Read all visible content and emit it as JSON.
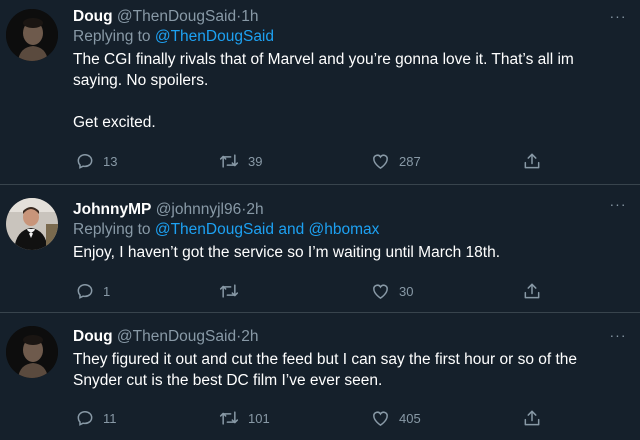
{
  "tweets": [
    {
      "name": "Doug",
      "handle": "@ThenDougSaid",
      "dot": "·",
      "time": "1h",
      "reply_prefix": "Replying to ",
      "reply_to": [
        "@ThenDougSaid"
      ],
      "reply_joiner": "",
      "paragraphs": [
        "The CGI finally rivals that of Marvel and you’re gonna love it. That’s all im saying. No spoilers.",
        "Get excited."
      ],
      "replies": "13",
      "retweets": "39",
      "likes": "287"
    },
    {
      "name": "JohnnyMP",
      "handle": "@johnnyjl96",
      "dot": "·",
      "time": "2h",
      "reply_prefix": "Replying to ",
      "reply_to": [
        "@ThenDougSaid",
        "@hbomax"
      ],
      "reply_joiner": " and ",
      "paragraphs": [
        "Enjoy, I haven’t got the service so I’m waiting until March 18th."
      ],
      "replies": "1",
      "retweets": "",
      "likes": "30"
    },
    {
      "name": "Doug",
      "handle": "@ThenDougSaid",
      "dot": "·",
      "time": "2h",
      "paragraphs": [
        "They figured it out and cut the feed but I can say the first hour or so of the Snyder cut is the best DC film I’ve ever seen."
      ],
      "replies": "11",
      "retweets": "101",
      "likes": "405"
    }
  ],
  "icons": {
    "reply": "reply-icon",
    "retweet": "retweet-icon",
    "like": "heart-icon",
    "share": "share-icon",
    "more": "more-icon"
  },
  "colors": {
    "background": "#15202b",
    "border": "#38444d",
    "text": "#ffffff",
    "muted": "#8899a6",
    "link": "#1da1f2"
  }
}
